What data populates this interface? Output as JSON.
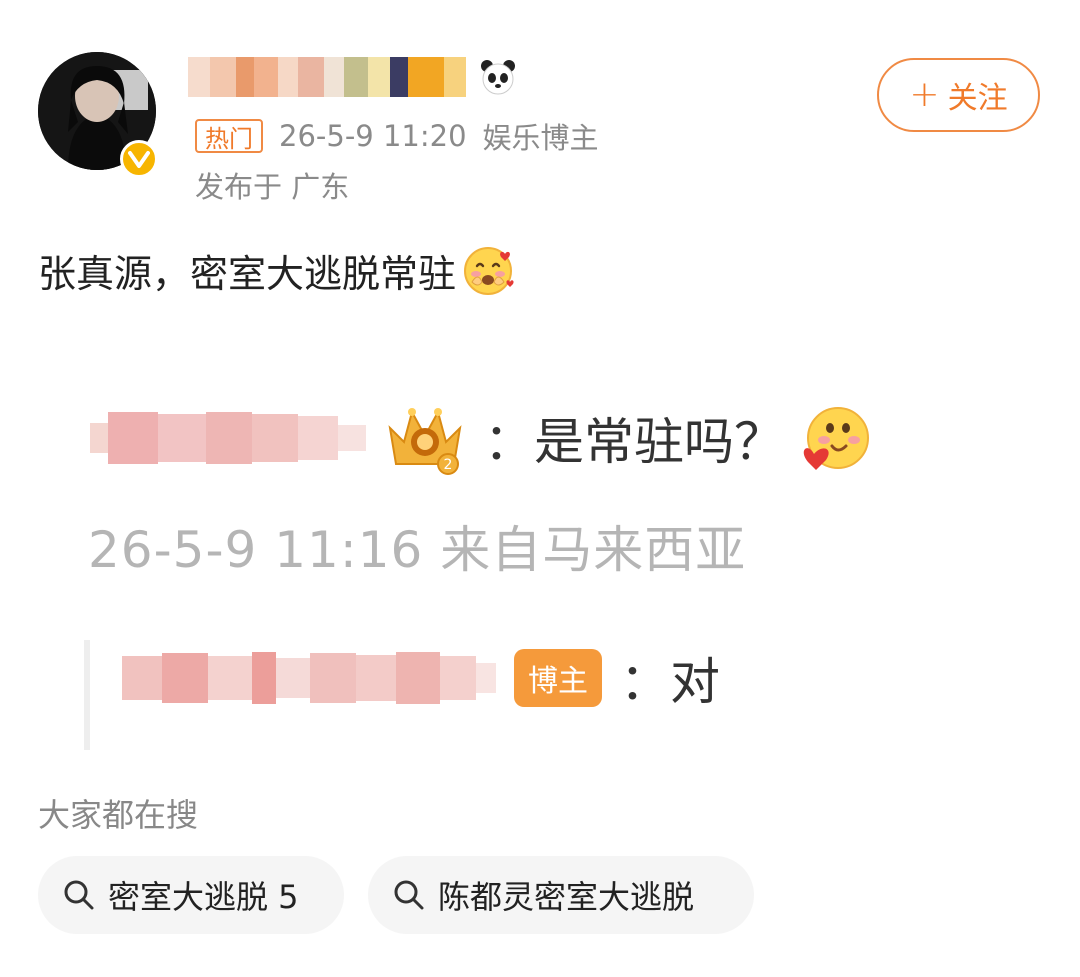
{
  "post": {
    "hot_label": "热门",
    "time": "26-5-9 11:20",
    "category": "娱乐博主",
    "location": "发布于 广东",
    "follow_label": "关注",
    "follow_plus": "+",
    "text": "张真源，密室大逃脱常驻"
  },
  "screenshot": {
    "comment_text": "：是常驻吗？",
    "comment_meta": "26-5-9 11:16 来自马来西亚",
    "author_badge": "博主",
    "reply_text": "：对"
  },
  "search": {
    "title": "大家都在搜",
    "items": [
      {
        "label": "密室大逃脱 5"
      },
      {
        "label": "陈都灵密室大逃脱"
      }
    ]
  },
  "colors": {
    "accent": "#f07a2a",
    "badge_orange": "#f59a3b",
    "verified": "#f7b500",
    "muted_text": "#8a8a8a"
  },
  "icons": [
    "verified-v-icon",
    "panda-icon",
    "blush-emoji-icon",
    "crown-icon",
    "love-emoji-icon",
    "search-icon"
  ]
}
